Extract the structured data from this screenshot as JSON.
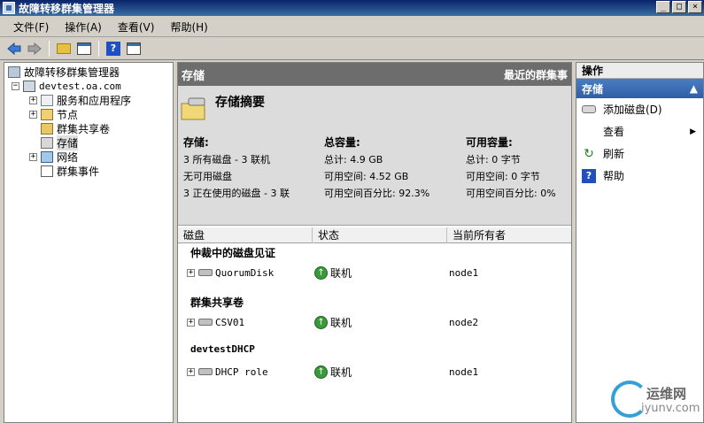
{
  "window": {
    "title": "故障转移群集管理器",
    "controls": [
      "_",
      "□",
      "×"
    ]
  },
  "menu": [
    "文件(F)",
    "操作(A)",
    "查看(V)",
    "帮助(H)"
  ],
  "tree": {
    "root": "故障转移群集管理器",
    "cluster": "devtest.oa.com",
    "items": [
      {
        "label": "服务和应用程序",
        "icon": "services-icon",
        "expandable": true
      },
      {
        "label": "节点",
        "icon": "nodes-icon",
        "expandable": true
      },
      {
        "label": "群集共享卷",
        "icon": "csv-icon",
        "expandable": false
      },
      {
        "label": "存储",
        "icon": "storage-icon",
        "expandable": false,
        "selected": true
      },
      {
        "label": "网络",
        "icon": "network-icon",
        "expandable": true
      },
      {
        "label": "群集事件",
        "icon": "events-icon",
        "expandable": false
      }
    ]
  },
  "center": {
    "header_title": "存储",
    "header_right": "最近的群集事",
    "summary_title": "存储摘要",
    "storage_col": {
      "heading": "存储:",
      "lines": [
        "3 所有磁盘 - 3 联机",
        "无可用磁盘",
        "3 正在使用的磁盘 - 3 联"
      ]
    },
    "total_col": {
      "heading": "总容量:",
      "lines": [
        "总计: 4.9 GB",
        "可用空间: 4.52 GB",
        "可用空间百分比: 92.3%"
      ]
    },
    "available_col": {
      "heading": "可用容量:",
      "lines": [
        "总计: 0 字节",
        "可用空间: 0 字节",
        "可用空间百分比: 0%"
      ]
    },
    "columns": [
      "磁盘",
      "状态",
      "当前所有者"
    ],
    "groups": [
      {
        "label": "仲裁中的磁盘见证",
        "disk": "QuorumDisk",
        "status": "联机",
        "owner": "node1"
      },
      {
        "label": "群集共享卷",
        "disk": "CSV01",
        "status": "联机",
        "owner": "node2"
      },
      {
        "label": "devtestDHCP",
        "disk": "DHCP role",
        "status": "联机",
        "owner": "node1"
      }
    ]
  },
  "actions": {
    "header": "操作",
    "section": "存储",
    "items": [
      "添加磁盘(D)",
      "查看",
      "刷新",
      "帮助"
    ]
  },
  "watermark": {
    "cn": "运维网",
    "en": "iyunv.com"
  }
}
